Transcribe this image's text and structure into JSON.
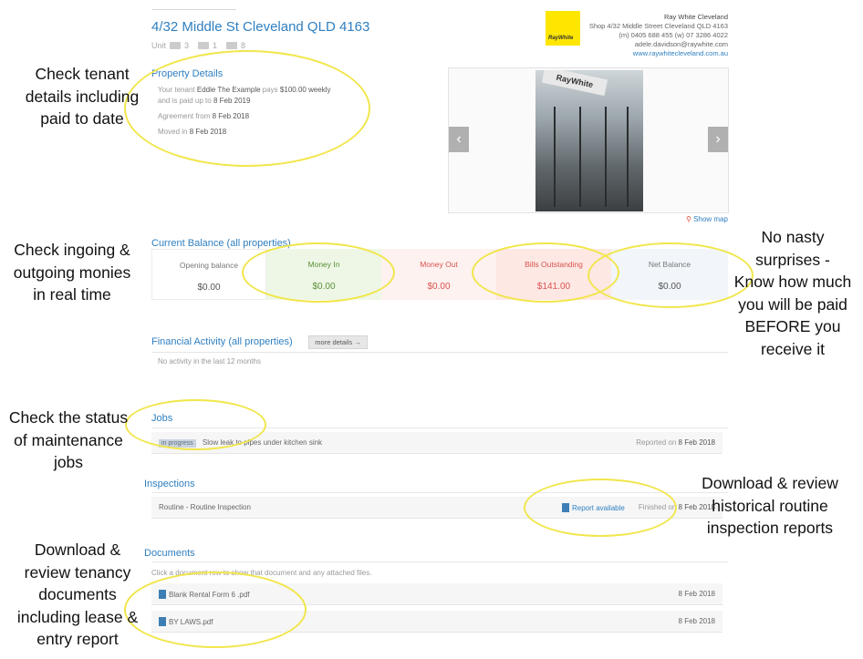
{
  "header": {
    "address": "4/32 Middle St Cleveland QLD 4163",
    "unit_label": "Unit",
    "bedrooms": "3",
    "bathrooms": "1",
    "carspaces": "8"
  },
  "agency": {
    "logo_text": "RayWhite",
    "name": "Ray White Cleveland",
    "address": "Shop 4/32 Middle Street Cleveland QLD 4163",
    "phones": "(m) 0405 688 455 (w) 07 3286 4022",
    "email": "adele.davidson@raywhite.com",
    "website": "www.raywhitecleveland.com.au"
  },
  "property_details": {
    "heading": "Property Details",
    "line1_prefix": "Your tenant",
    "tenant_name": "Eddie The Example",
    "line1_mid": "pays",
    "rent": "$100.00 weekly",
    "line2_prefix": "and is paid up to",
    "paid_to": "8 Feb 2019",
    "agreement_prefix": "Agreement from",
    "agreement_date": "8 Feb 2018",
    "moved_prefix": "Moved in",
    "moved_date": "8 Feb 2018"
  },
  "photo": {
    "sign_text": "RayWhite",
    "prev_label": "‹",
    "next_label": "›",
    "show_map": "Show map"
  },
  "balance": {
    "heading": "Current Balance (all properties)",
    "cells": [
      {
        "label": "Opening balance",
        "value": "$0.00"
      },
      {
        "label": "Money In",
        "value": "$0.00"
      },
      {
        "label": "Money Out",
        "value": "$0.00"
      },
      {
        "label": "Bills Outstanding",
        "value": "$141.00"
      },
      {
        "label": "Net Balance",
        "value": "$0.00"
      }
    ],
    "colors": {
      "opening_bg": "#ffffff",
      "money_in_bg": "#eef7e6",
      "money_in_text": "#5a8f36",
      "money_out_bg": "#fdf2ef",
      "money_out_text": "#d9534f",
      "bills_bg": "#fde8e4",
      "bills_text": "#d9534f",
      "net_bg": "#f2f6fb"
    }
  },
  "financial": {
    "heading": "Financial Activity (all properties)",
    "more_button": "more details →",
    "empty_text": "No activity in the last 12 months"
  },
  "jobs": {
    "heading": "Jobs",
    "items": [
      {
        "status": "in progress",
        "description": "Slow leak to pipes under kitchen sink",
        "reported_prefix": "Reported on",
        "reported_date": "8 Feb 2018"
      }
    ]
  },
  "inspections": {
    "heading": "Inspections",
    "items": [
      {
        "title": "Routine - Routine Inspection",
        "report_link": "Report available",
        "finished_prefix": "Finished on",
        "finished_date": "8 Feb 2018"
      }
    ]
  },
  "documents": {
    "heading": "Documents",
    "hint": "Click a document row to show that document and any attached files.",
    "items": [
      {
        "name": "Blank Rental Form 6 .pdf",
        "date": "8 Feb 2018"
      },
      {
        "name": "BY LAWS.pdf",
        "date": "8 Feb 2018"
      }
    ]
  },
  "annotations": {
    "tenant": [
      "Check tenant",
      "details including",
      "paid to date"
    ],
    "monies": [
      "Check ingoing &",
      "outgoing monies",
      "in real time"
    ],
    "net": [
      "No nasty",
      "surprises -",
      "Know how much",
      "you will be paid",
      "BEFORE you",
      "receive it"
    ],
    "jobs": [
      "Check the status",
      "of maintenance",
      "jobs"
    ],
    "inspections": [
      "Download & review",
      "historical routine",
      "inspection reports"
    ],
    "documents": [
      "Download &",
      "review tenancy",
      "documents",
      "including lease &",
      "entry report"
    ],
    "ring_color": "#f1e64b"
  }
}
